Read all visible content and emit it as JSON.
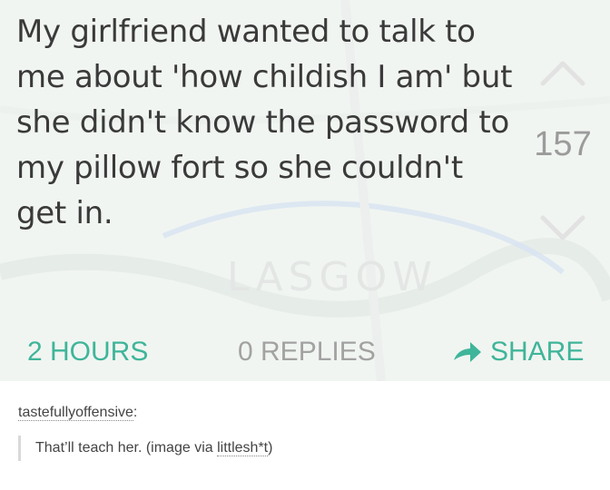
{
  "post": {
    "text": "My girlfriend wanted to talk to me about 'how childish I am' but she didn't know the password to my pillow fort so she couldn't get in.",
    "vote_count": "157",
    "time": "2 HOURS",
    "replies": "0 REPLIES",
    "share_label": "SHARE",
    "map_watermark": "LASGOW"
  },
  "caption": {
    "source_user": "tastefullyoffensive",
    "source_colon": ":",
    "quote_text": "That’ll teach her. (image via ",
    "quote_link": "littlesh*t",
    "quote_end": ")"
  },
  "colors": {
    "accent": "#3fb59a",
    "muted": "#a2a2a2",
    "text": "#3a3a3a"
  },
  "icons": {
    "upvote": "chevron-up-icon",
    "downvote": "chevron-down-icon",
    "share": "share-arrow-icon"
  }
}
